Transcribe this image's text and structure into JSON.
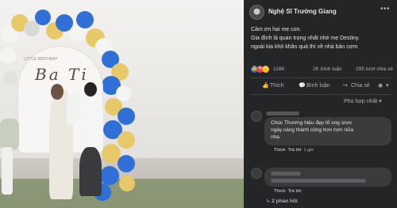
{
  "photo": {
    "banner_small": "LITTLE BIRTHDAY",
    "banner_name": "Ba Ti",
    "colors": {
      "blue": "#2f6fd6",
      "yellow": "#e8c96a",
      "white": "#f4f4f2"
    }
  },
  "post": {
    "author": "Nghệ Sĩ Trường Giang",
    "more_icon": "more-dots-icon",
    "caption_lines": [
      "Cảm ơn hai mẹ con.",
      "Gia đình là quan trọng nhất nhé mẹ Destiny.",
      "ngoài kia khó khăn quá thì về nhà bản cơm"
    ],
    "reactions": [
      "like-reaction-icon",
      "love-reaction-icon",
      "haha-reaction-icon"
    ],
    "reaction_count": "118K",
    "comment_count": "2K bình luận",
    "share_count": "295 lượt chia sẻ",
    "actions": {
      "like": "Thích",
      "comment": "Bình luận",
      "share": "Chia sẻ"
    },
    "sort_label": "Phù hợp nhất ▾"
  },
  "comments": [
    {
      "text_lines": [
        "Chúc Thương hiệu đẹp tổ ong snvv",
        "ngày càng thành công hơn hơn nữa",
        "nha"
      ],
      "like": "Thích",
      "reply": "Trả lời",
      "time": "1 giờ"
    },
    {
      "like": "Thích",
      "reply": "Trả lời",
      "reply_count": "2 phản hồi"
    }
  ],
  "theme": {
    "card_bg": "#242526",
    "bubble_bg": "#3a3b3c",
    "text": "#e4e6eb",
    "muted": "#b0b3b8"
  }
}
